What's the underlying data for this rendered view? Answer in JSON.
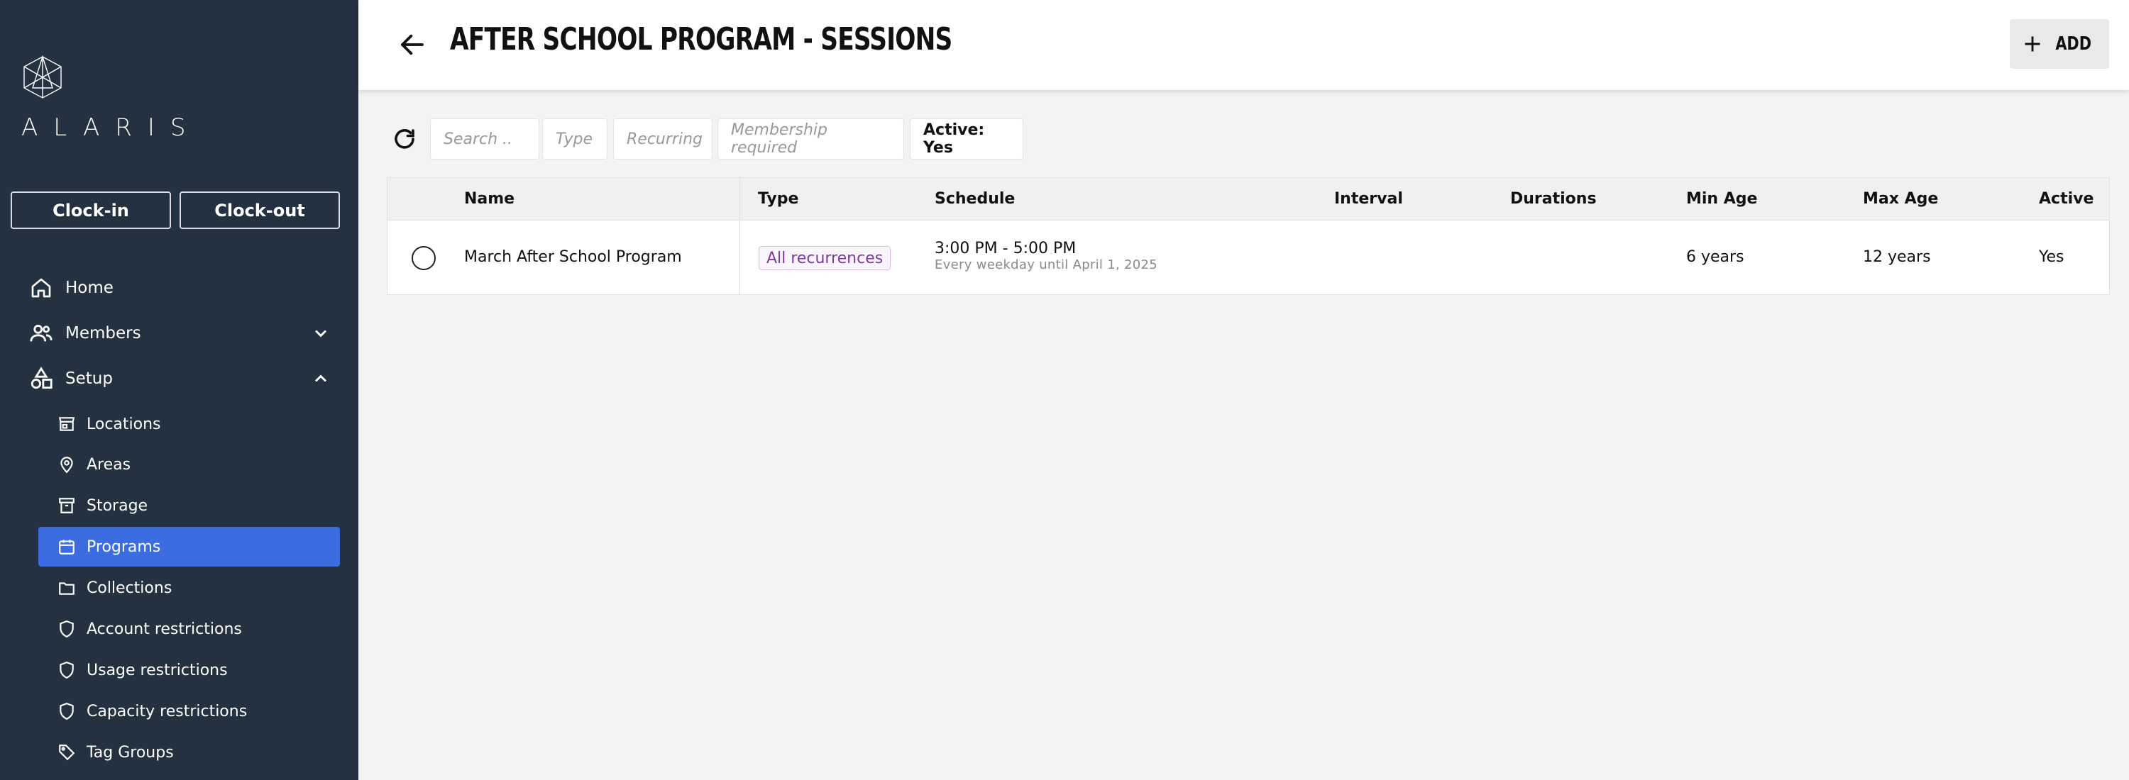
{
  "sidebar": {
    "logo_text": "ALARIS",
    "clock_in_label": "Clock-in",
    "clock_out_label": "Clock-out",
    "nav": [
      {
        "label": "Home",
        "icon": "home-icon"
      },
      {
        "label": "Members",
        "icon": "members-icon",
        "expanded": false
      },
      {
        "label": "Setup",
        "icon": "setup-icon",
        "expanded": true
      }
    ],
    "setup_items": [
      {
        "label": "Locations",
        "icon": "store-icon"
      },
      {
        "label": "Areas",
        "icon": "map-pin-icon"
      },
      {
        "label": "Storage",
        "icon": "archive-icon"
      },
      {
        "label": "Programs",
        "icon": "calendar-icon",
        "active": true
      },
      {
        "label": "Collections",
        "icon": "folder-icon"
      },
      {
        "label": "Account restrictions",
        "icon": "shield-icon"
      },
      {
        "label": "Usage restrictions",
        "icon": "shield-icon"
      },
      {
        "label": "Capacity restrictions",
        "icon": "shield-icon"
      },
      {
        "label": "Tag Groups",
        "icon": "tag-icon"
      }
    ]
  },
  "header": {
    "title": "AFTER SCHOOL PROGRAM - SESSIONS",
    "add_label": "ADD"
  },
  "filters": {
    "search_placeholder": "Search ..",
    "type": "Type",
    "recurring": "Recurring",
    "membership": "Membership required",
    "active": "Active: Yes"
  },
  "table": {
    "columns": [
      "Name",
      "Type",
      "Schedule",
      "Interval",
      "Durations",
      "Min Age",
      "Max Age",
      "Active"
    ],
    "rows": [
      {
        "name": "March After School Program",
        "type": "All recurrences",
        "schedule_time": "3:00 PM - 5:00 PM",
        "schedule_desc": "Every weekday until April 1, 2025",
        "interval": "",
        "durations": "",
        "min_age": "6 years",
        "max_age": "12 years",
        "active": "Yes"
      }
    ]
  },
  "colors": {
    "sidebar_bg": "#243140",
    "active_item": "#3b6de0",
    "badge_text": "#7a3aa0"
  }
}
